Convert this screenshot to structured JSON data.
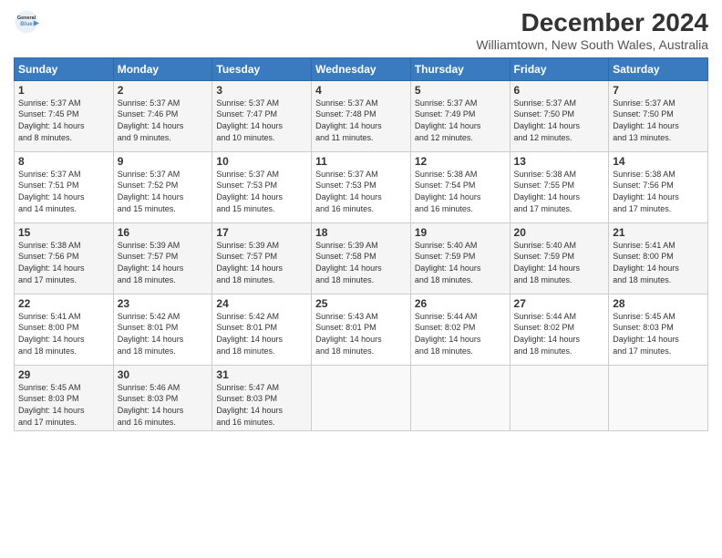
{
  "header": {
    "logo_line1": "General",
    "logo_line2": "Blue",
    "title": "December 2024",
    "subtitle": "Williamtown, New South Wales, Australia"
  },
  "days_of_week": [
    "Sunday",
    "Monday",
    "Tuesday",
    "Wednesday",
    "Thursday",
    "Friday",
    "Saturday"
  ],
  "weeks": [
    [
      {
        "day": 1,
        "sunrise": "5:37 AM",
        "sunset": "7:45 PM",
        "daylight": "14 hours and 8 minutes."
      },
      {
        "day": 2,
        "sunrise": "5:37 AM",
        "sunset": "7:46 PM",
        "daylight": "14 hours and 9 minutes."
      },
      {
        "day": 3,
        "sunrise": "5:37 AM",
        "sunset": "7:47 PM",
        "daylight": "14 hours and 10 minutes."
      },
      {
        "day": 4,
        "sunrise": "5:37 AM",
        "sunset": "7:48 PM",
        "daylight": "14 hours and 11 minutes."
      },
      {
        "day": 5,
        "sunrise": "5:37 AM",
        "sunset": "7:49 PM",
        "daylight": "14 hours and 12 minutes."
      },
      {
        "day": 6,
        "sunrise": "5:37 AM",
        "sunset": "7:50 PM",
        "daylight": "14 hours and 12 minutes."
      },
      {
        "day": 7,
        "sunrise": "5:37 AM",
        "sunset": "7:50 PM",
        "daylight": "14 hours and 13 minutes."
      }
    ],
    [
      {
        "day": 8,
        "sunrise": "5:37 AM",
        "sunset": "7:51 PM",
        "daylight": "14 hours and 14 minutes."
      },
      {
        "day": 9,
        "sunrise": "5:37 AM",
        "sunset": "7:52 PM",
        "daylight": "14 hours and 15 minutes."
      },
      {
        "day": 10,
        "sunrise": "5:37 AM",
        "sunset": "7:53 PM",
        "daylight": "14 hours and 15 minutes."
      },
      {
        "day": 11,
        "sunrise": "5:37 AM",
        "sunset": "7:53 PM",
        "daylight": "14 hours and 16 minutes."
      },
      {
        "day": 12,
        "sunrise": "5:38 AM",
        "sunset": "7:54 PM",
        "daylight": "14 hours and 16 minutes."
      },
      {
        "day": 13,
        "sunrise": "5:38 AM",
        "sunset": "7:55 PM",
        "daylight": "14 hours and 17 minutes."
      },
      {
        "day": 14,
        "sunrise": "5:38 AM",
        "sunset": "7:56 PM",
        "daylight": "14 hours and 17 minutes."
      }
    ],
    [
      {
        "day": 15,
        "sunrise": "5:38 AM",
        "sunset": "7:56 PM",
        "daylight": "14 hours and 17 minutes."
      },
      {
        "day": 16,
        "sunrise": "5:39 AM",
        "sunset": "7:57 PM",
        "daylight": "14 hours and 18 minutes."
      },
      {
        "day": 17,
        "sunrise": "5:39 AM",
        "sunset": "7:57 PM",
        "daylight": "14 hours and 18 minutes."
      },
      {
        "day": 18,
        "sunrise": "5:39 AM",
        "sunset": "7:58 PM",
        "daylight": "14 hours and 18 minutes."
      },
      {
        "day": 19,
        "sunrise": "5:40 AM",
        "sunset": "7:59 PM",
        "daylight": "14 hours and 18 minutes."
      },
      {
        "day": 20,
        "sunrise": "5:40 AM",
        "sunset": "7:59 PM",
        "daylight": "14 hours and 18 minutes."
      },
      {
        "day": 21,
        "sunrise": "5:41 AM",
        "sunset": "8:00 PM",
        "daylight": "14 hours and 18 minutes."
      }
    ],
    [
      {
        "day": 22,
        "sunrise": "5:41 AM",
        "sunset": "8:00 PM",
        "daylight": "14 hours and 18 minutes."
      },
      {
        "day": 23,
        "sunrise": "5:42 AM",
        "sunset": "8:01 PM",
        "daylight": "14 hours and 18 minutes."
      },
      {
        "day": 24,
        "sunrise": "5:42 AM",
        "sunset": "8:01 PM",
        "daylight": "14 hours and 18 minutes."
      },
      {
        "day": 25,
        "sunrise": "5:43 AM",
        "sunset": "8:01 PM",
        "daylight": "14 hours and 18 minutes."
      },
      {
        "day": 26,
        "sunrise": "5:44 AM",
        "sunset": "8:02 PM",
        "daylight": "14 hours and 18 minutes."
      },
      {
        "day": 27,
        "sunrise": "5:44 AM",
        "sunset": "8:02 PM",
        "daylight": "14 hours and 18 minutes."
      },
      {
        "day": 28,
        "sunrise": "5:45 AM",
        "sunset": "8:03 PM",
        "daylight": "14 hours and 17 minutes."
      }
    ],
    [
      {
        "day": 29,
        "sunrise": "5:45 AM",
        "sunset": "8:03 PM",
        "daylight": "14 hours and 17 minutes."
      },
      {
        "day": 30,
        "sunrise": "5:46 AM",
        "sunset": "8:03 PM",
        "daylight": "14 hours and 16 minutes."
      },
      {
        "day": 31,
        "sunrise": "5:47 AM",
        "sunset": "8:03 PM",
        "daylight": "14 hours and 16 minutes."
      },
      null,
      null,
      null,
      null
    ]
  ],
  "labels": {
    "sunrise": "Sunrise:",
    "sunset": "Sunset:",
    "daylight": "Daylight:"
  }
}
